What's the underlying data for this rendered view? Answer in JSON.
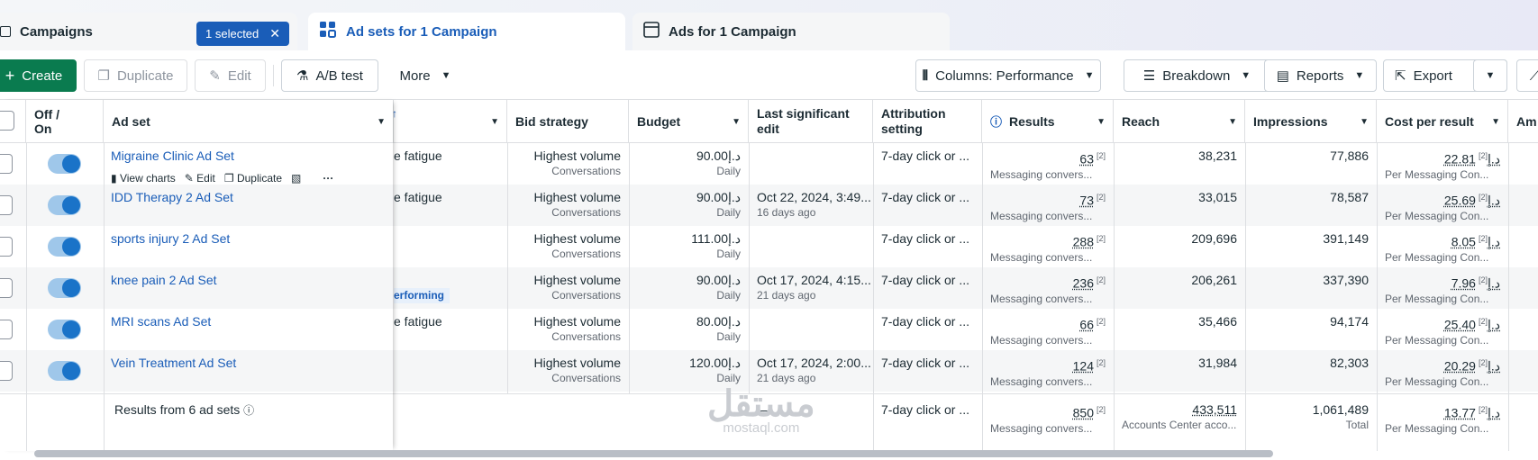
{
  "tabs": {
    "campaigns": "Campaigns",
    "selected": "1 selected",
    "adsets": "Ad sets for 1 Campaign",
    "ads": "Ads for 1 Campaign"
  },
  "toolbar": {
    "create": "Create",
    "duplicate": "Duplicate",
    "edit": "Edit",
    "abtest": "A/B test",
    "more": "More",
    "columns": "Columns: Performance",
    "breakdown": "Breakdown",
    "reports": "Reports",
    "export": "Export"
  },
  "headers": {
    "offon": "Off / On",
    "adset": "Ad set",
    "bid": "Bid strategy",
    "budget": "Budget",
    "lastedit": "Last significant edit",
    "attribution": "Attribution setting",
    "results": "Results",
    "reach": "Reach",
    "impressions": "Impressions",
    "cpr": "Cost per result",
    "amount": "Am"
  },
  "row_actions": {
    "view_charts": "View charts",
    "edit": "Edit",
    "duplicate": "Duplicate"
  },
  "rows": [
    {
      "name": "Migraine Clinic Ad Set",
      "delivery": "e fatigue",
      "bid": "Highest volume",
      "bid_sub": "Conversations",
      "budget": "90.00د.إ",
      "budget_sub": "Daily",
      "edit": "",
      "edit_sub": "",
      "attr": "7-day click or ...",
      "results": "63",
      "results_sub": "Messaging convers...",
      "reach": "38,231",
      "impressions": "77,886",
      "cpr": "22.81د.إ",
      "cpr_sub": "Per Messaging Con..."
    },
    {
      "name": "IDD Therapy 2 Ad Set",
      "delivery": "e fatigue",
      "bid": "Highest volume",
      "bid_sub": "Conversations",
      "budget": "90.00د.إ",
      "budget_sub": "Daily",
      "edit": "Oct 22, 2024, 3:49...",
      "edit_sub": "16 days ago",
      "attr": "7-day click or ...",
      "results": "73",
      "results_sub": "Messaging convers...",
      "reach": "33,015",
      "impressions": "78,587",
      "cpr": "25.69د.إ",
      "cpr_sub": "Per Messaging Con..."
    },
    {
      "name": "sports injury 2 Ad Set",
      "delivery": "",
      "bid": "Highest volume",
      "bid_sub": "Conversations",
      "budget": "111.00د.إ",
      "budget_sub": "Daily",
      "edit": "",
      "edit_sub": "",
      "attr": "7-day click or ...",
      "results": "288",
      "results_sub": "Messaging convers...",
      "reach": "209,696",
      "impressions": "391,149",
      "cpr": "8.05د.إ",
      "cpr_sub": "Per Messaging Con..."
    },
    {
      "name": "knee pain 2 Ad Set",
      "delivery": "erforming",
      "bid": "Highest volume",
      "bid_sub": "Conversations",
      "budget": "90.00د.إ",
      "budget_sub": "Daily",
      "edit": "Oct 17, 2024, 4:15...",
      "edit_sub": "21 days ago",
      "attr": "7-day click or ...",
      "results": "236",
      "results_sub": "Messaging convers...",
      "reach": "206,261",
      "impressions": "337,390",
      "cpr": "7.96د.إ",
      "cpr_sub": "Per Messaging Con..."
    },
    {
      "name": "MRI scans Ad Set",
      "delivery": "e fatigue",
      "bid": "Highest volume",
      "bid_sub": "Conversations",
      "budget": "80.00د.إ",
      "budget_sub": "Daily",
      "edit": "",
      "edit_sub": "",
      "attr": "7-day click or ...",
      "results": "66",
      "results_sub": "Messaging convers...",
      "reach": "35,466",
      "impressions": "94,174",
      "cpr": "25.40د.إ",
      "cpr_sub": "Per Messaging Con..."
    },
    {
      "name": "Vein Treatment Ad Set",
      "delivery": "",
      "bid": "Highest volume",
      "bid_sub": "Conversations",
      "budget": "120.00د.إ",
      "budget_sub": "Daily",
      "edit": "Oct 17, 2024, 2:00...",
      "edit_sub": "21 days ago",
      "attr": "7-day click or ...",
      "results": "124",
      "results_sub": "Messaging convers...",
      "reach": "31,984",
      "impressions": "82,303",
      "cpr": "20.29د.إ",
      "cpr_sub": "Per Messaging Con..."
    }
  ],
  "sup_mark": "[2]",
  "totals": {
    "label": "Results from 6 ad sets",
    "bid": "—",
    "attr": "7-day click or ...",
    "results": "850",
    "results_sub": "Messaging convers...",
    "reach": "433,511",
    "reach_sub": "Accounts Center acco...",
    "impressions": "1,061,489",
    "impressions_sub": "Total",
    "cpr": "13.77د.إ",
    "cpr_sub": "Per Messaging Con..."
  },
  "watermark": {
    "arabic": "مستقل",
    "latin": "mostaql.com"
  }
}
